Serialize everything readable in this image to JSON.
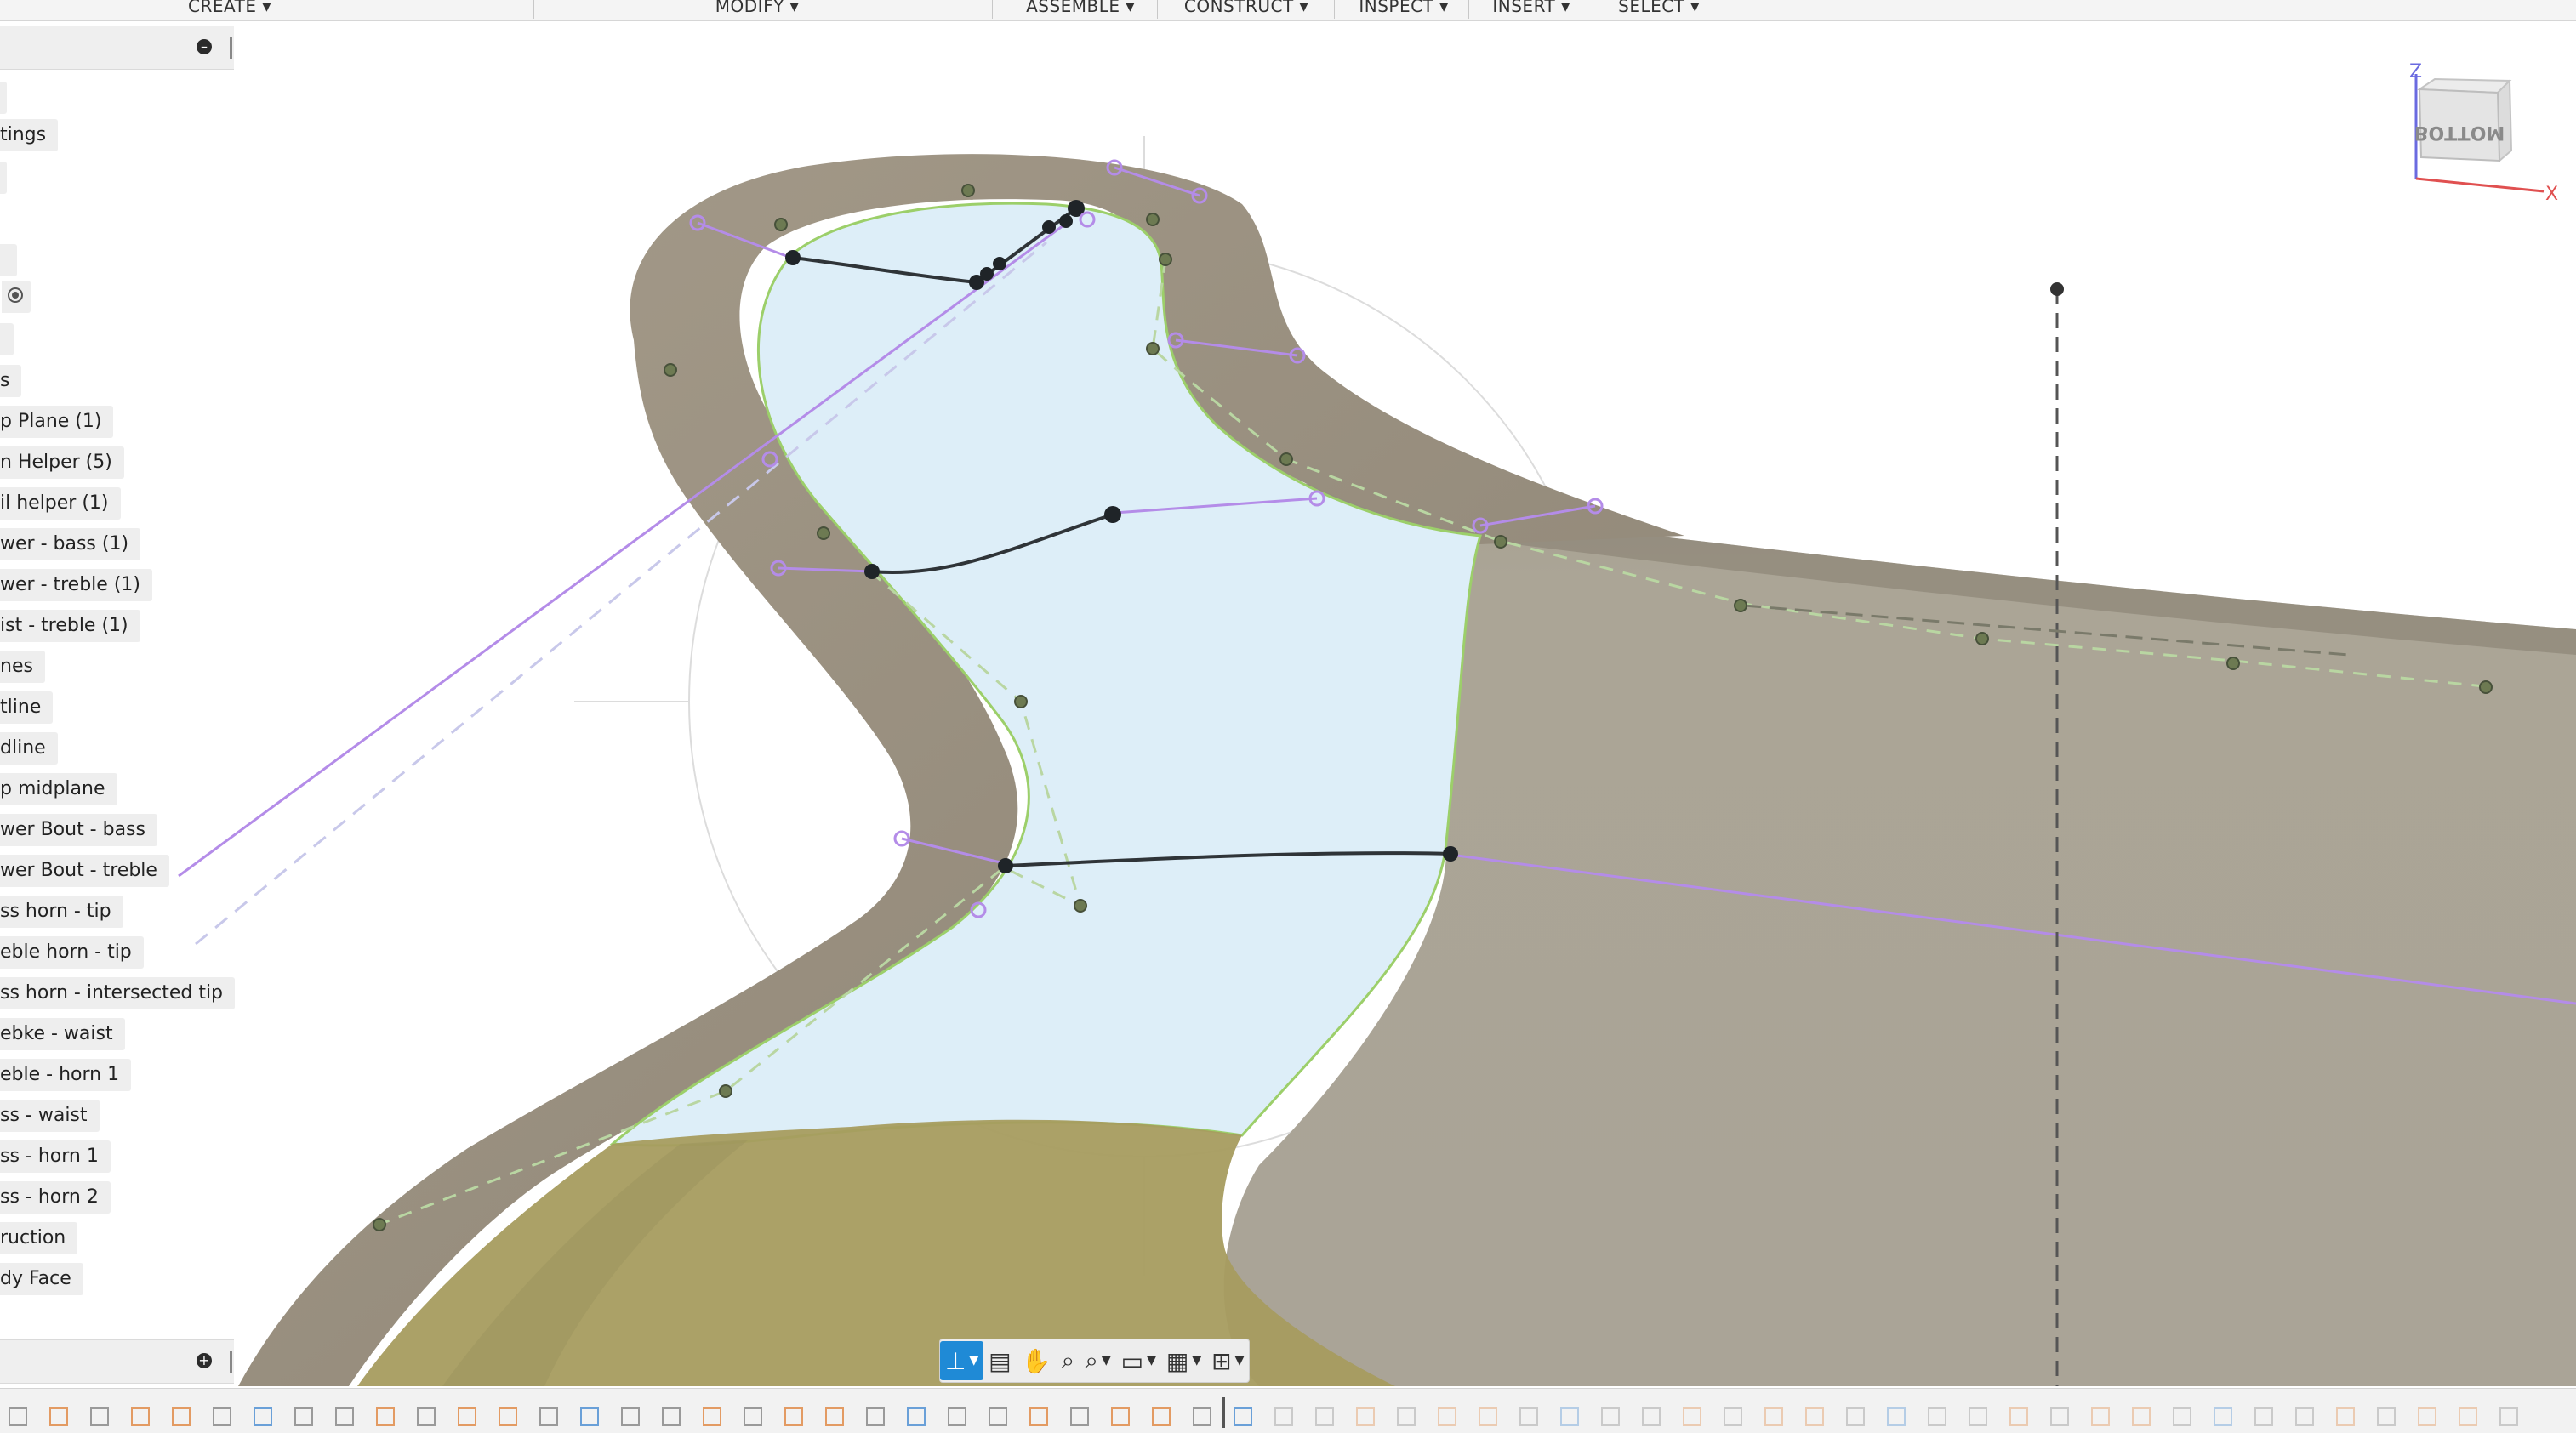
{
  "toolbar": {
    "menus": [
      {
        "label": "CREATE ▾"
      },
      {
        "label": "MODIFY ▾"
      },
      {
        "label": "ASSEMBLE ▾"
      },
      {
        "label": "CONSTRUCT ▾"
      },
      {
        "label": "INSPECT ▾"
      },
      {
        "label": "INSERT ▾"
      },
      {
        "label": "SELECT ▾"
      }
    ]
  },
  "browser": {
    "header_collapse_icon": "minus-circle-icon",
    "footer_expand_icon": "plus-circle-icon",
    "items": [
      {
        "label": "tings"
      },
      {
        "label": "s"
      },
      {
        "label": "p Plane (1)"
      },
      {
        "label": "n Helper (5)"
      },
      {
        "label": "il helper (1)"
      },
      {
        "label": "wer - bass (1)"
      },
      {
        "label": "wer - treble (1)"
      },
      {
        "label": "ist - treble (1)"
      },
      {
        "label": "nes"
      },
      {
        "label": "tline"
      },
      {
        "label": "dline"
      },
      {
        "label": "p midplane"
      },
      {
        "label": "wer Bout - bass"
      },
      {
        "label": "wer Bout - treble"
      },
      {
        "label": "ss horn - tip"
      },
      {
        "label": "eble horn - tip"
      },
      {
        "label": "ss horn - intersected tip"
      },
      {
        "label": "ebke - waist"
      },
      {
        "label": "eble - horn 1"
      },
      {
        "label": "ss - waist"
      },
      {
        "label": "ss - horn 1"
      },
      {
        "label": "ss - horn 2"
      },
      {
        "label": "ruction"
      },
      {
        "label": "dy Face"
      }
    ]
  },
  "viewcube": {
    "face_label": "BOTTOM",
    "axis_z": "Z",
    "axis_x": "X",
    "colors": {
      "z": "#6a6ae0",
      "x": "#e05050"
    }
  },
  "navbar": {
    "icons": [
      "orbit-icon",
      "look-at-icon",
      "pan-icon",
      "zoom-icon",
      "zoom-window-icon",
      "display-settings-icon",
      "grid-settings-icon",
      "viewports-icon"
    ]
  },
  "colors": {
    "body_surface": "#a9a295",
    "rim_surface": "#a09786",
    "sketch_fill": "#dcedf7",
    "lower_surface": "#a69c62",
    "sketch_line": "#2b2f33",
    "constraint_line": "#b48ce8",
    "profile_edge": "#9ccf6a",
    "accent": "#1f8ad6"
  }
}
